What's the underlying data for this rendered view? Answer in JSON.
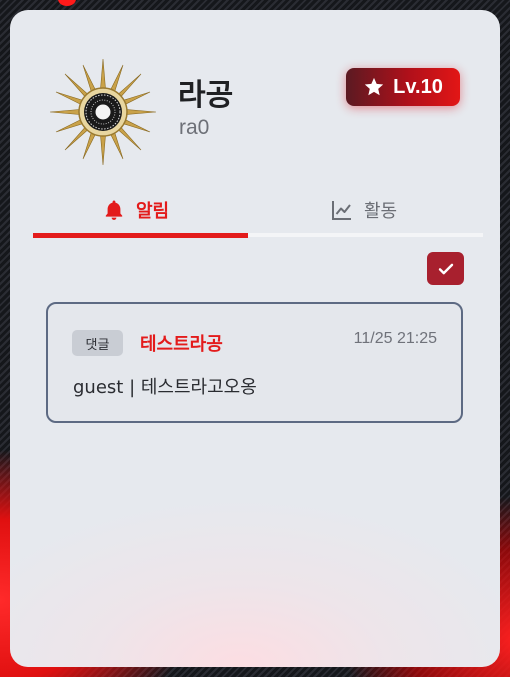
{
  "profile": {
    "name": "라공",
    "handle": "ra0",
    "level": "Lv.10",
    "avatar_icon": "sun-emblem-icon"
  },
  "tabs": [
    {
      "label": "알림",
      "icon": "bell-icon",
      "active": true
    },
    {
      "label": "활동",
      "icon": "chart-line-icon",
      "active": false
    }
  ],
  "actions": {
    "mark_all_read_icon": "check-icon"
  },
  "notifications": [
    {
      "badge": "댓글",
      "title": "테스트라공",
      "time": "11/25 21:25",
      "message": "guest | 테스트라고오옹"
    }
  ],
  "colors": {
    "accent": "#e31b1b",
    "level_badge": "#b0101a",
    "check_button": "#a8202e",
    "card_bg": "#e6e9ee"
  }
}
